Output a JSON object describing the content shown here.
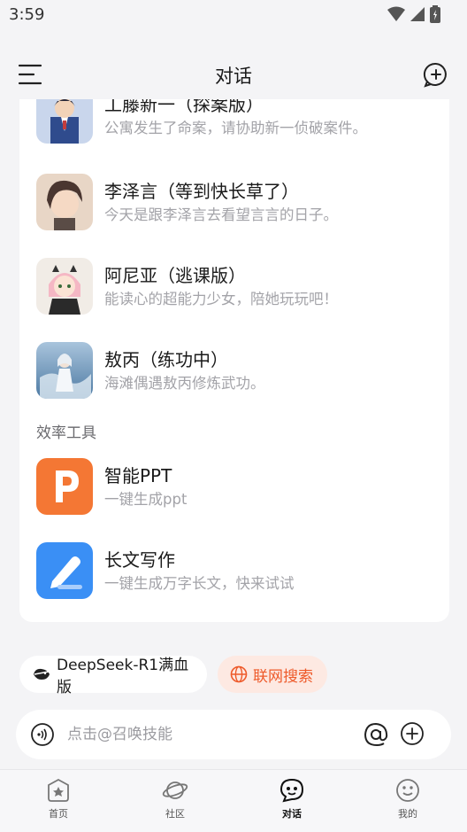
{
  "status_bar": {
    "time": "3:59"
  },
  "header": {
    "title": "对话"
  },
  "characters": [
    {
      "title": "工藤新一（探案版）",
      "desc": "公寓发生了命案，请协助新一侦破案件。"
    },
    {
      "title": "李泽言（等到快长草了）",
      "desc": "今天是跟李泽言去看望言言的日子。"
    },
    {
      "title": "阿尼亚（逃课版）",
      "desc": "能读心的超能力少女，陪她玩玩吧！"
    },
    {
      "title": "敖丙（练功中）",
      "desc": "海滩偶遇敖丙修炼武功。"
    }
  ],
  "tools_section": {
    "label": "效率工具"
  },
  "tools": [
    {
      "title": "智能PPT",
      "desc": "一键生成ppt",
      "icon_color": "#f47734"
    },
    {
      "title": "长文写作",
      "desc": "一键生成万字长文，快来试试",
      "icon_color": "#3a8ff5"
    }
  ],
  "chips": {
    "deepseek": "DeepSeek-R1满血版",
    "search": "联网搜索"
  },
  "input": {
    "placeholder": "点击@召唤技能",
    "value": ""
  },
  "nav": [
    {
      "label": "首页"
    },
    {
      "label": "社区"
    },
    {
      "label": "对话"
    },
    {
      "label": "我的"
    }
  ],
  "colors": {
    "accent": "#ee5a2a",
    "chip_bg": "#fde9e2",
    "card_bg": "#ffffff",
    "page_bg": "#f4f4f6"
  }
}
